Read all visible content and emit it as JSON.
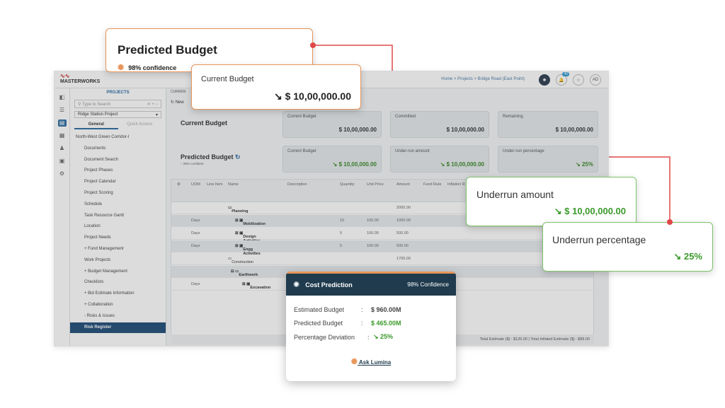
{
  "app": {
    "logo_top": "rojal",
    "logo": "MASTERWORKS",
    "logo_sub": "CLOUD",
    "breadcrumb": "Home > Projects > Bridge Road (East Point)",
    "notification_count": "40",
    "avatar": "AD"
  },
  "sidebar": {
    "title": "PROJECTS",
    "search_placeholder": "Type to Search",
    "project": "Ridge Station Project",
    "tabs": [
      "General",
      "Quick Access"
    ],
    "root": "North-West Green Corridor-I",
    "items": [
      "Documents",
      "Document Search",
      "Project Phases",
      "Project Calendar",
      "Project Scoring",
      "Schedule",
      "Task Resource Gantt",
      "Location",
      "Project Needs",
      "+ Fund Management",
      "Work Projects",
      "+ Budget Management",
      "Checklists",
      "+ Bid Estimate Information",
      "+ Collaboration",
      "- Risks & Issues",
      "Risk Register"
    ]
  },
  "main": {
    "tab": "CURREN",
    "new_label": "New",
    "current_budget_label": "Current Budget",
    "predicted_budget_label": "Predicted Budget",
    "predicted_conf_small": "98% confident",
    "cards_row1": [
      {
        "label": "Current Budget",
        "value": "$ 10,00,000.00"
      },
      {
        "label": "Committed",
        "value": "$ 10,00,000.00"
      },
      {
        "label": "Remaining",
        "value": "$ 10,00,000.00"
      }
    ],
    "cards_row2": [
      {
        "label": "Current Budget",
        "value": "$ 10,00,000.00"
      },
      {
        "label": "Under-run amount",
        "value": "$ 10,00,000.00"
      },
      {
        "label": "Under-run percentage",
        "value": "25%"
      }
    ]
  },
  "grid": {
    "headers": [
      "UOM",
      "Line Item",
      "Name",
      "Description",
      "Quantity",
      "Unit Price",
      "Amount",
      "Fund Rule",
      "Inflation R"
    ],
    "rows": [
      {
        "uom": "",
        "name": "Planning",
        "qty": "",
        "price": "",
        "amount": "2000.00"
      },
      {
        "uom": "Days",
        "name": "Mobilization",
        "qty": "10",
        "price": "100.00",
        "amount": "1000.00"
      },
      {
        "uom": "Days",
        "name": "Design Activities",
        "qty": "5",
        "price": "100.00",
        "amount": "500.00"
      },
      {
        "uom": "Days",
        "name": "Engg Activities",
        "qty": "5",
        "price": "100.00",
        "amount": "500.00"
      },
      {
        "uom": "",
        "name": "Construction",
        "qty": "",
        "price": "",
        "amount": "1700.00"
      },
      {
        "uom": "",
        "name": "Earthwork",
        "qty": "",
        "price": "",
        "amount": ""
      },
      {
        "uom": "Days",
        "name": "Excavation",
        "qty": "",
        "price": "",
        "amount": ""
      }
    ],
    "right_cells": [
      "50",
      "50",
      "170",
      "1000.00 $600.00 32%",
      "1000.00 $400.00 25%"
    ],
    "footer": "Total Estimate ($) : $126.00 | Total Inflated Estimate ($) : $89.00"
  },
  "callouts": {
    "predicted_title": "Predicted Budget",
    "predicted_confidence": "98% confidence",
    "current_title": "Current Budget",
    "current_value": "$ 10,00,000.00",
    "underrun_amount_title": "Underrun amount",
    "underrun_amount_value": "$ 10,00,000.00",
    "underrun_pct_title": "Underrun percentage",
    "underrun_pct_value": "25%"
  },
  "cost_prediction": {
    "title": "Cost Prediction",
    "confidence": "98% Confidence",
    "rows": [
      {
        "label": "Estimated Budget",
        "value": "$ 960.00M"
      },
      {
        "label": "Predicted Budget",
        "value": "$ 465.00M"
      },
      {
        "label": "Percentage Deviation",
        "value": "25%"
      }
    ],
    "ask": "Ask Lumina"
  },
  "colors": {
    "accent_orange": "#e8955a",
    "accent_green": "#3a9a2a",
    "connector_red": "#e04848",
    "header_dark": "#1f3b4d"
  }
}
